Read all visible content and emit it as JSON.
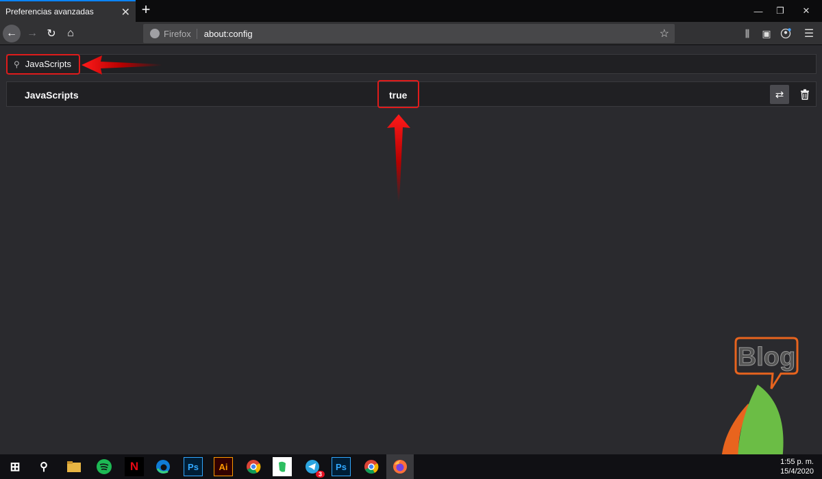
{
  "tab": {
    "title": "Preferencias avanzadas"
  },
  "urlbar": {
    "identity_label": "Firefox",
    "url": "about:config"
  },
  "search": {
    "value": "JavaScripts"
  },
  "pref_row": {
    "name": "JavaScripts",
    "value": "true"
  },
  "taskbar": {
    "telegram_badge": "3",
    "clock_time": "1:55 p. m.",
    "clock_date": "15/4/2020"
  },
  "logo": {
    "text": "Blog"
  },
  "colors": {
    "accent": "#0a84ff",
    "highlight": "#e01b1b",
    "background": "#2a2a2e"
  }
}
